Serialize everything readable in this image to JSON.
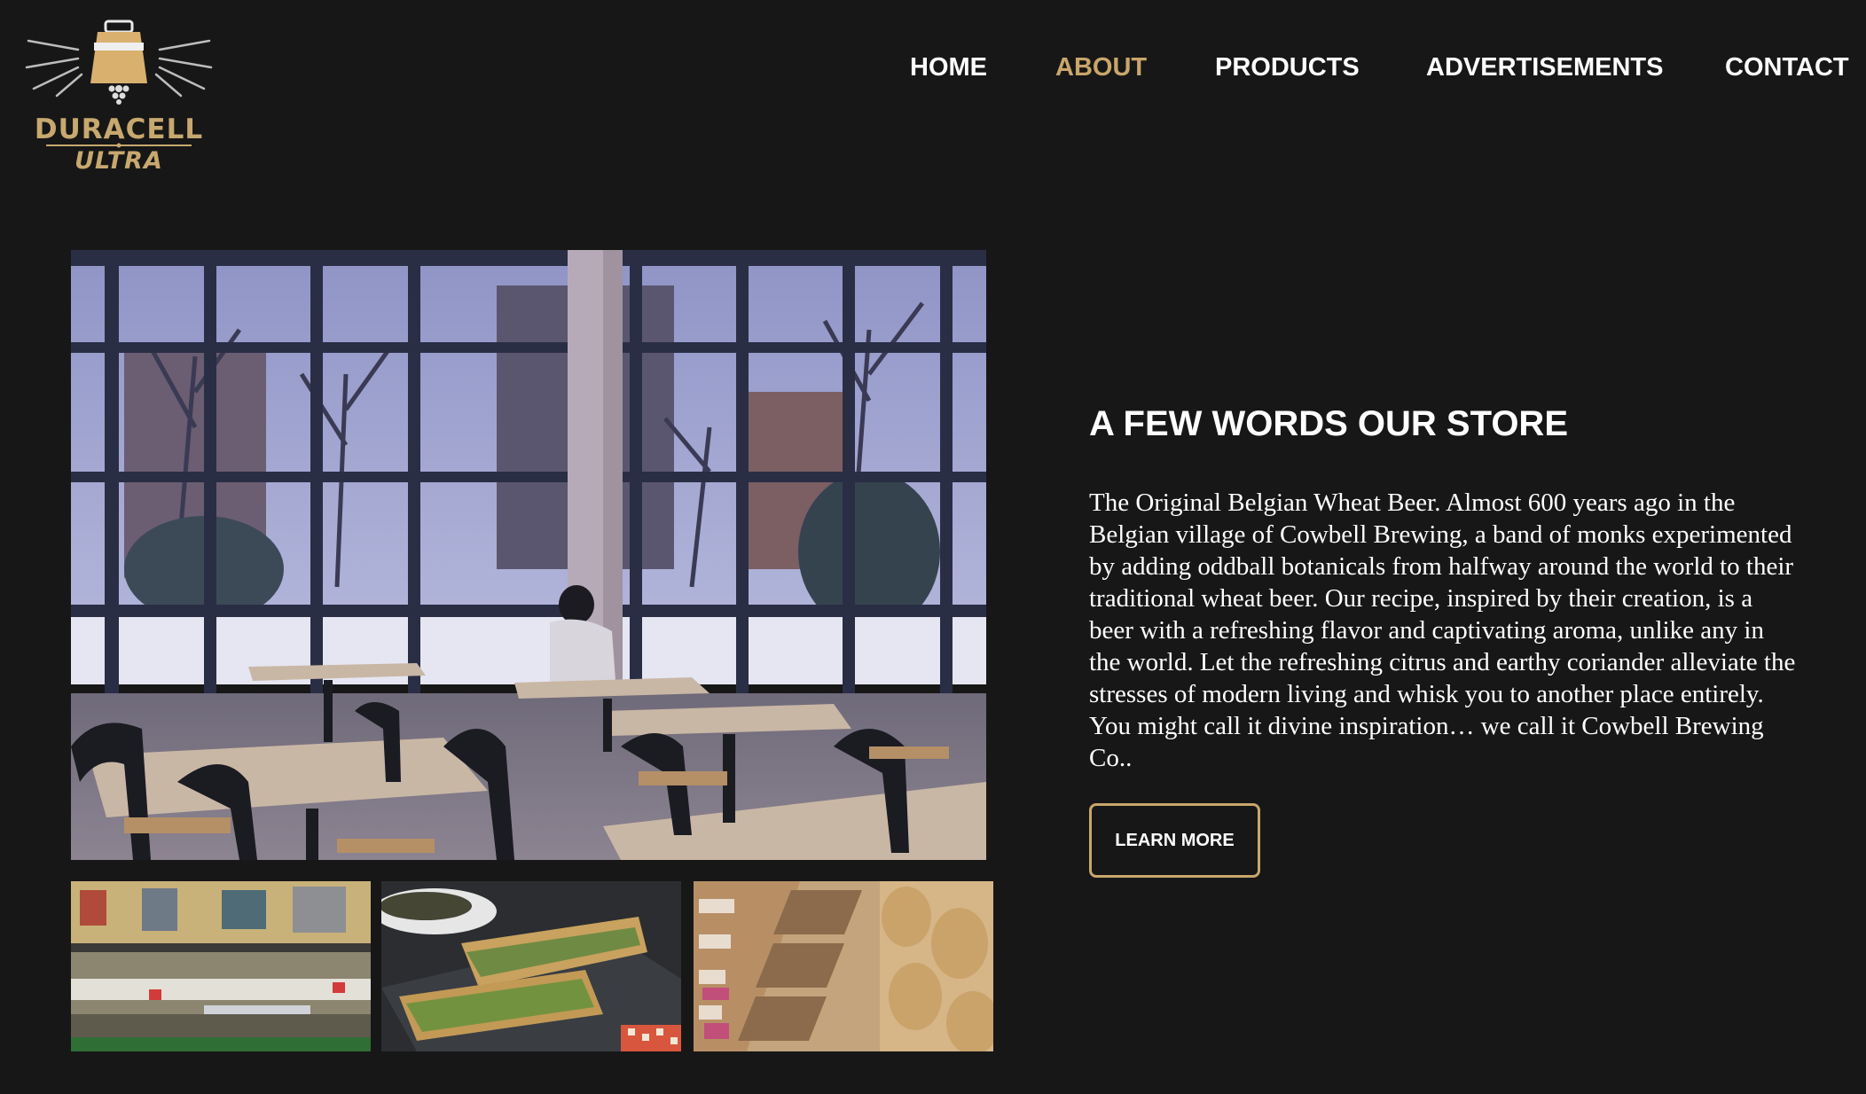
{
  "logo": {
    "brand": "DURACELL",
    "subtitle": "ULTRA"
  },
  "nav": {
    "items": [
      {
        "label": "HOME",
        "active": false
      },
      {
        "label": "ABOUT",
        "active": true
      },
      {
        "label": "PRODUCTS",
        "active": false
      },
      {
        "label": "ADVERTISEMENTS",
        "active": false
      },
      {
        "label": "CONTACT",
        "active": false
      }
    ]
  },
  "about": {
    "heading": "A FEW WORDS OUR STORE",
    "body": "The Original Belgian Wheat Beer. Almost 600 years ago in the Belgian village of Cowbell Brewing, a band of monks experimented by adding oddball botanicals from halfway around the world to their traditional wheat beer. Our recipe, inspired by their creation, is a beer with a refreshing flavor and captivating aroma, unlike any in the world. Let the refreshing citrus and earthy coriander alleviate the stresses of modern living and whisk you to another place entirely. You might call it divine inspiration… we call it Cowbell Brewing Co..",
    "button_label": "LEARN MORE"
  },
  "colors": {
    "background": "#171717",
    "accent": "#c9a66b",
    "text": "#ffffff"
  }
}
